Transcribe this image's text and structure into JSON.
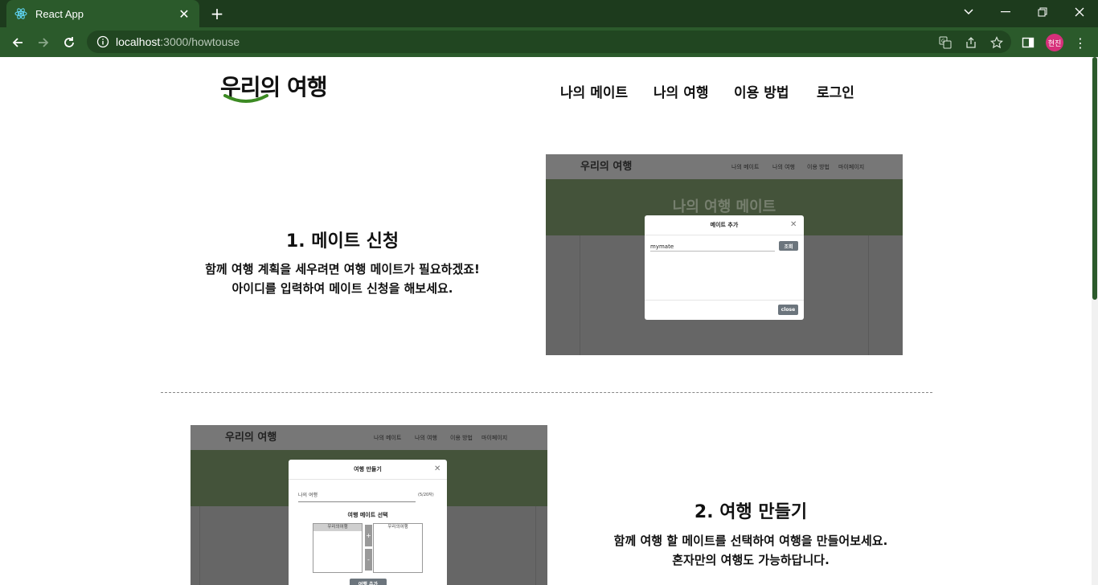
{
  "browser": {
    "tab_title": "React App",
    "url_host": "localhost",
    "url_path": ":3000/howtouse",
    "profile_initials": "현진"
  },
  "site": {
    "logo_main": "우리의",
    "logo_accent": "리",
    "logo_tail": "여행",
    "nav": [
      "나의 메이트",
      "나의 여행",
      "이용 방법",
      "로그인"
    ]
  },
  "section1": {
    "title": "1. 메이트 신청",
    "desc_line1": "함께 여행 계획을 세우려면 여행 메이트가 필요하겠죠!",
    "desc_line2": "아이디를 입력하여 메이트 신청을 해보세요.",
    "shot": {
      "logo": "우리의 여행",
      "nav": [
        "나의 메이트",
        "나의 여행",
        "이용 방법",
        "마이페이지"
      ],
      "banner_title": "나의 여행 메이트",
      "modal_title": "메이트 추가",
      "input_value": "mymate",
      "search_button": "조회",
      "close_button": "close"
    }
  },
  "section2": {
    "title": "2. 여행 만들기",
    "desc_line1": "함께 여행 할 메이트를 선택하여 여행을 만들어보세요.",
    "desc_line2": "혼자만의 여행도 가능하답니다.",
    "shot": {
      "logo": "우리의 여행",
      "nav": [
        "나의 메이트",
        "나의 여행",
        "이용 방법",
        "마이페이지"
      ],
      "modal_title": "여행 만들기",
      "trip_name": "나의 여행",
      "char_count": "(5/20자)",
      "select_label": "여행 메이트 선택",
      "left_list_item": "우리의여행",
      "right_list_item": "우리의여행",
      "plus": "+",
      "minus": "-",
      "create_button": "여행 추가"
    }
  }
}
